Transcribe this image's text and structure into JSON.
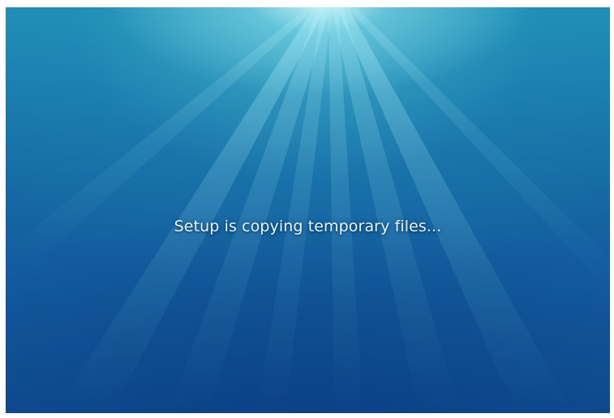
{
  "setup": {
    "status_message": "Setup is copying temporary files..."
  },
  "colors": {
    "background_top": "#1f8fb5",
    "background_bottom": "#0f4e92",
    "glow": "#dcffff",
    "text": "#e9f6fb"
  }
}
